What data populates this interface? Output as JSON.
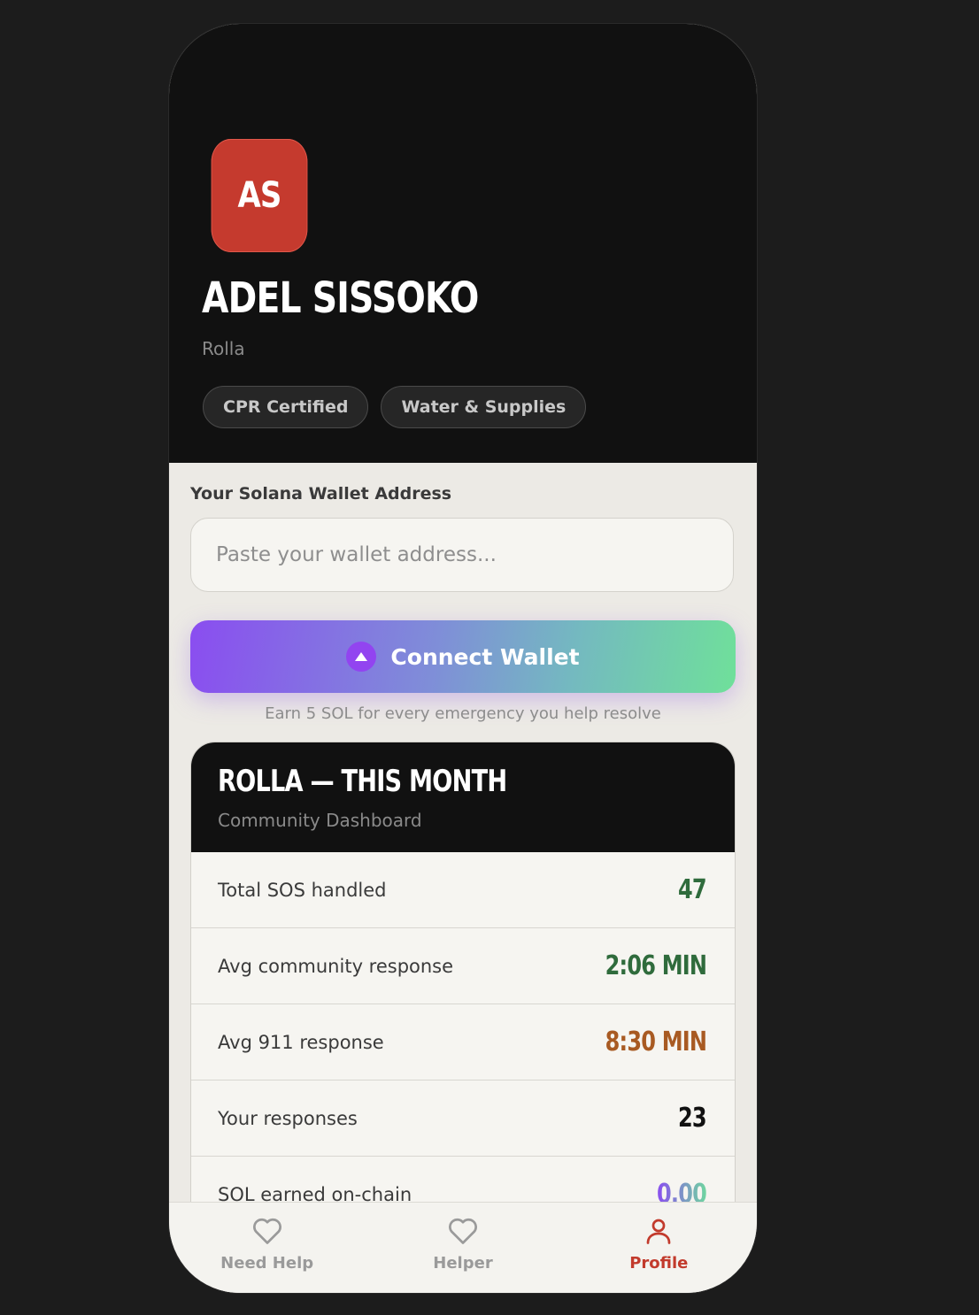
{
  "profile": {
    "initials": "AS",
    "name": "ADEL SISSOKO",
    "city": "Rolla",
    "tags": [
      "CPR Certified",
      "Water & Supplies"
    ],
    "avatar_color": "#c53a2e"
  },
  "wallet": {
    "label": "Your Solana Wallet Address",
    "placeholder": "Paste your wallet address...",
    "value": "",
    "connect_label": "Connect Wallet",
    "connect_icon": "solana-icon",
    "earn_note": "Earn 5 SOL for every emergency you help resolve"
  },
  "dashboard": {
    "title": "ROLLA — THIS MONTH",
    "subtitle": "Community Dashboard",
    "rows": [
      {
        "label": "Total SOS handled",
        "value": "47",
        "color": "#2f6b3c"
      },
      {
        "label": "Avg community response",
        "value": "2:06 MIN",
        "color": "#2f6b3c"
      },
      {
        "label": "Avg 911 response",
        "value": "8:30 MIN",
        "color": "#a85a22"
      },
      {
        "label": "Your responses",
        "value": "23",
        "color": "#111111"
      },
      {
        "label": "SOL earned on-chain",
        "value": "0.00",
        "color": "gradient"
      }
    ]
  },
  "nav": {
    "items": [
      {
        "label": "Need Help",
        "icon": "heart-icon",
        "active": false
      },
      {
        "label": "Helper",
        "icon": "heart-icon",
        "active": false
      },
      {
        "label": "Profile",
        "icon": "person-icon",
        "active": true
      }
    ],
    "active_color": "#c23a2c"
  }
}
